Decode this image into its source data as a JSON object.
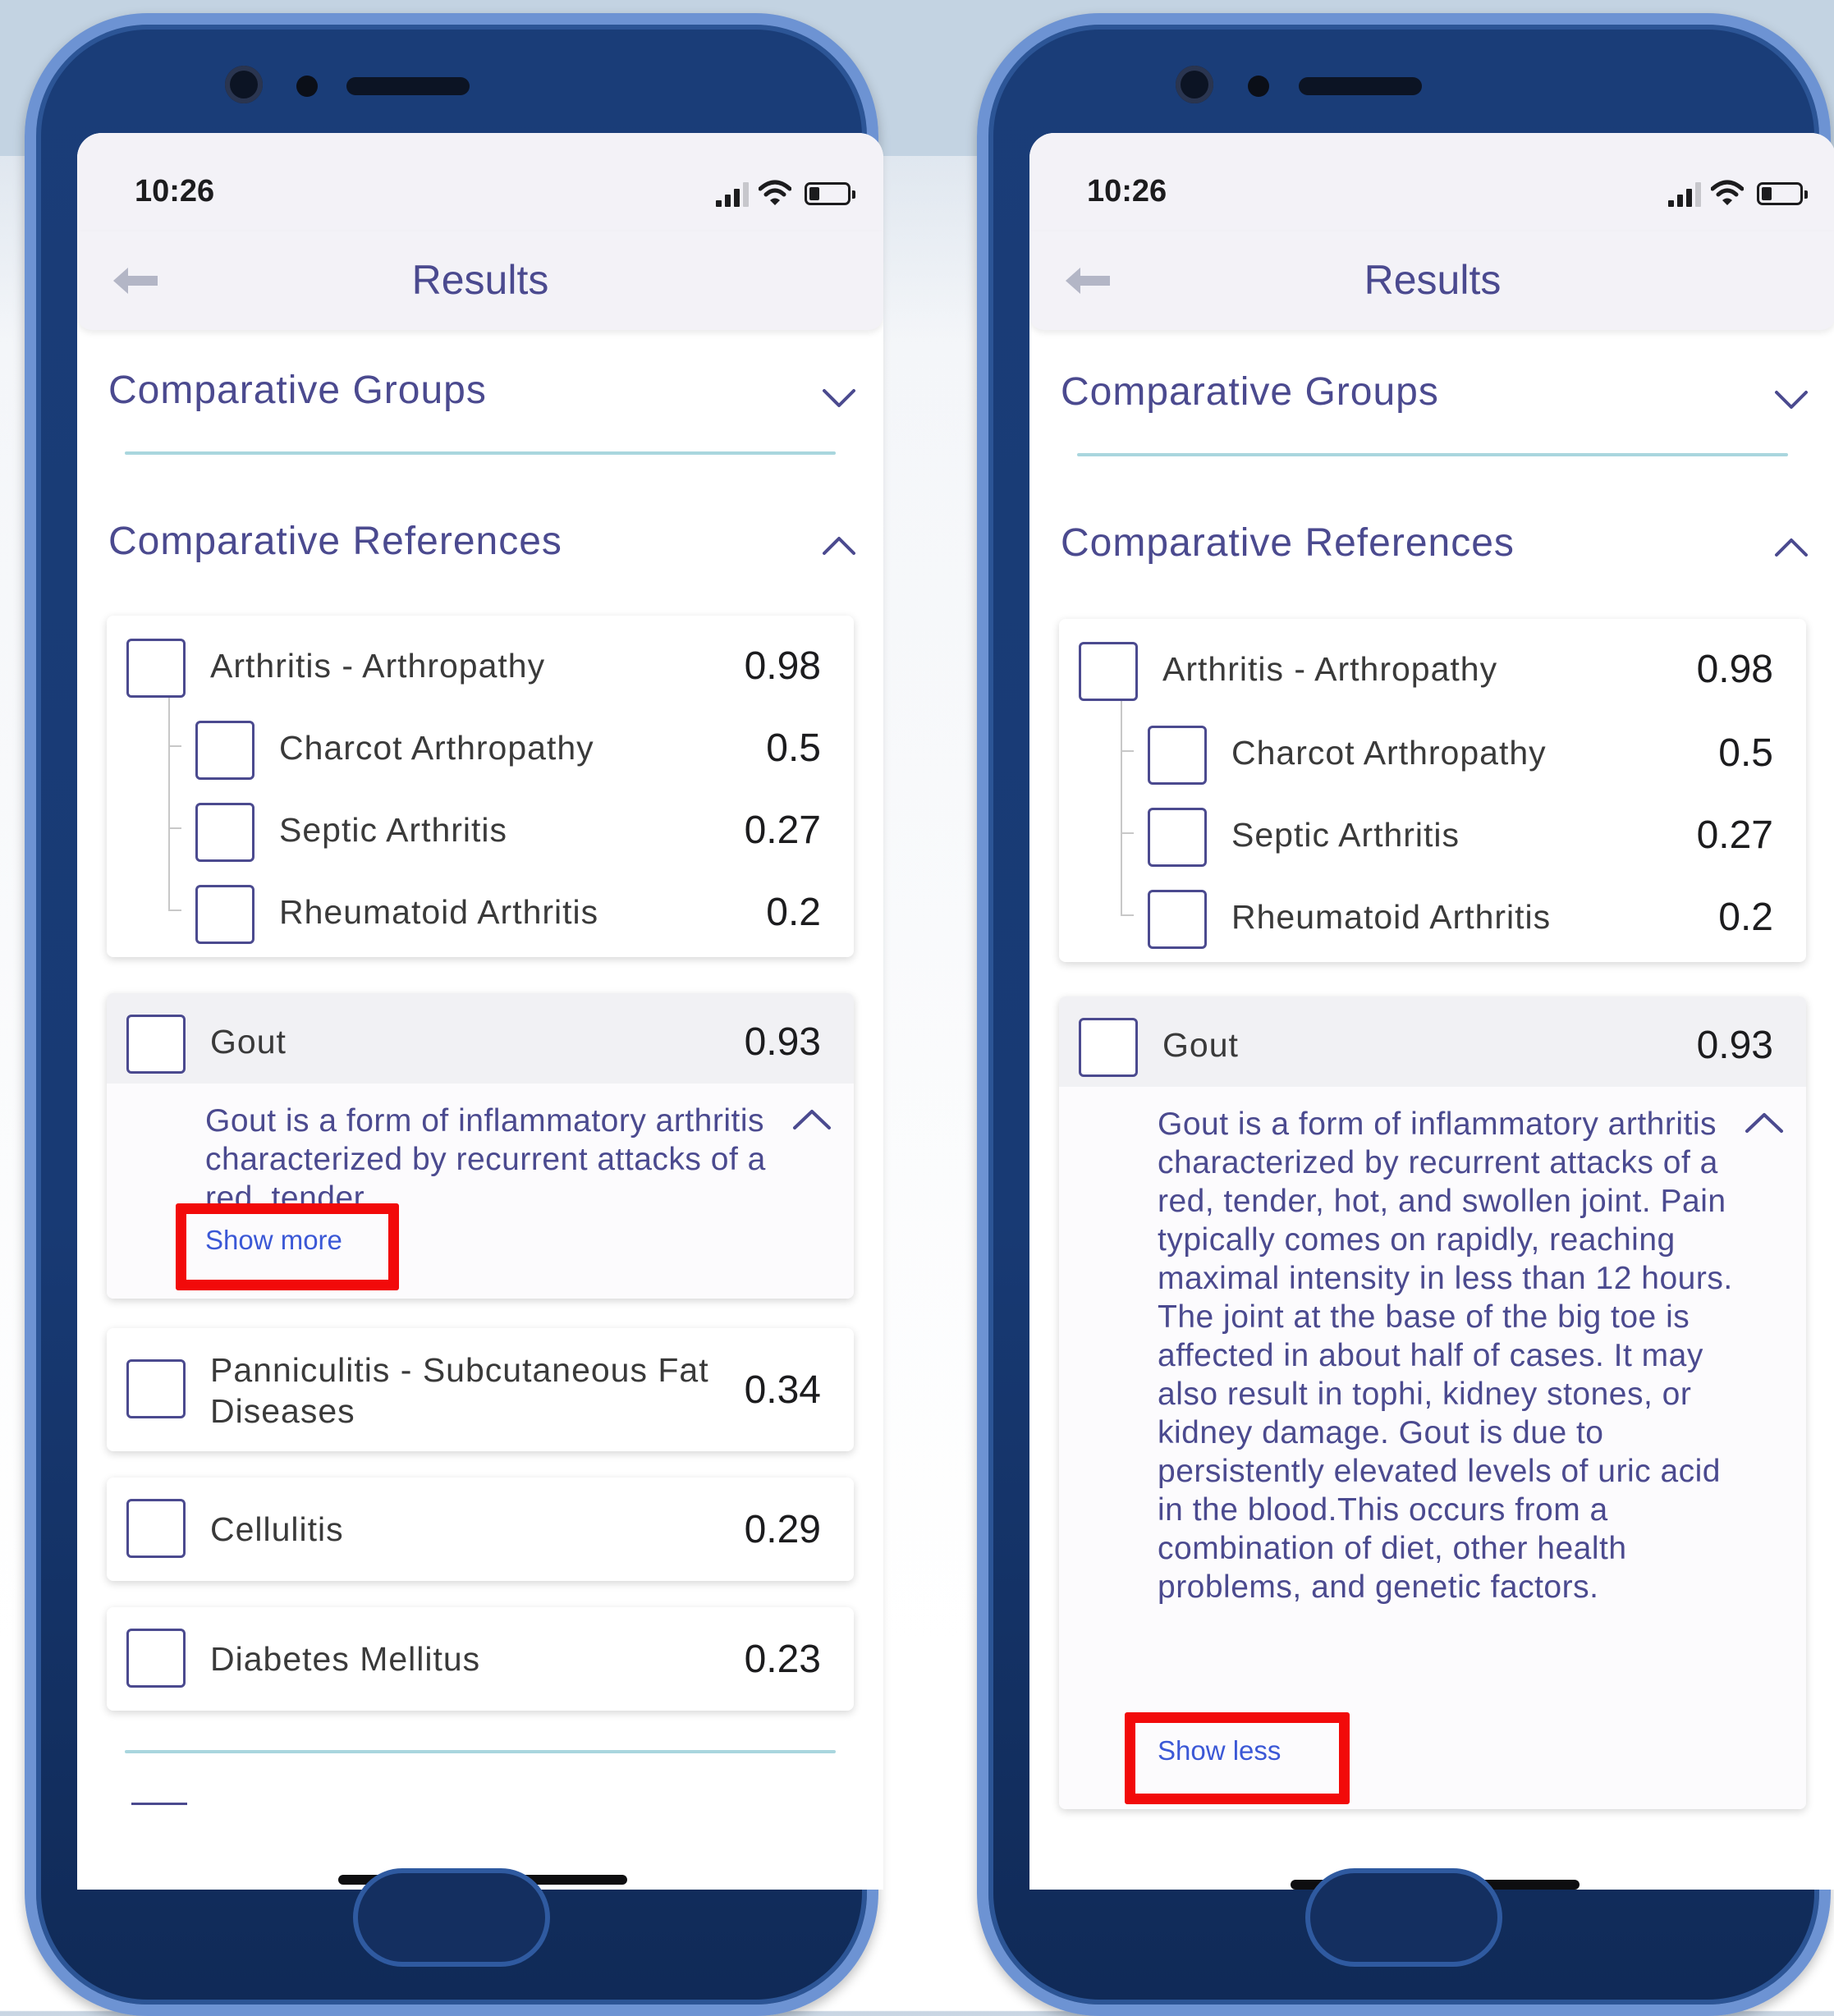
{
  "colors": {
    "accent_text": "#4b4a8f",
    "link": "#3b58d6",
    "divider": "#a9d6de",
    "highlight_box": "#f20a0a",
    "phone_body": "#1a3d78"
  },
  "screens": [
    {
      "status": {
        "time": "10:26"
      },
      "header": {
        "back_icon": "arrow-left-icon",
        "title": "Results"
      },
      "comparative_groups": {
        "title": "Comparative Groups",
        "state": "collapsed"
      },
      "comparative_references": {
        "title": "Comparative References",
        "state": "expanded"
      },
      "arthritis": {
        "label": "Arthritis - Arthropathy",
        "value": "0.98",
        "children": [
          {
            "label": "Charcot Arthropathy",
            "value": "0.5"
          },
          {
            "label": "Septic Arthritis",
            "value": "0.27"
          },
          {
            "label": "Rheumatoid Arthritis",
            "value": "0.2"
          }
        ]
      },
      "gout": {
        "label": "Gout",
        "value": "0.93",
        "description": "Gout is a form of inflammatory arthritis characterized by recurrent attacks of a red, tender,...",
        "toggle": "Show more"
      },
      "others": [
        {
          "label": "Panniculitis - Subcutaneous Fat Diseases",
          "value": "0.34"
        },
        {
          "label": "Cellulitis",
          "value": "0.29"
        },
        {
          "label": "Diabetes Mellitus",
          "value": "0.23"
        }
      ]
    },
    {
      "status": {
        "time": "10:26"
      },
      "header": {
        "back_icon": "arrow-left-icon",
        "title": "Results"
      },
      "comparative_groups": {
        "title": "Comparative Groups",
        "state": "collapsed"
      },
      "comparative_references": {
        "title": "Comparative References",
        "state": "expanded"
      },
      "arthritis": {
        "label": "Arthritis - Arthropathy",
        "value": "0.98",
        "children": [
          {
            "label": "Charcot Arthropathy",
            "value": "0.5"
          },
          {
            "label": "Septic Arthritis",
            "value": "0.27"
          },
          {
            "label": "Rheumatoid Arthritis",
            "value": "0.2"
          }
        ]
      },
      "gout": {
        "label": "Gout",
        "value": "0.93",
        "description": "Gout is a form of inflammatory arthritis characterized by recurrent attacks of a red, tender, hot, and swollen joint. Pain typically comes on rapidly, reaching maximal intensity in less than 12 hours. The joint at the base of the big toe is affected in about half of cases. It may also result in tophi, kidney stones, or kidney damage. Gout is due to persistently elevated levels of uric acid in the blood.This occurs from a combination of diet, other health problems, and genetic factors.",
        "toggle": "Show less"
      }
    }
  ]
}
